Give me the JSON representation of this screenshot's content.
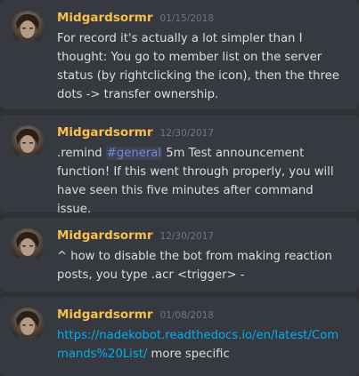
{
  "messages": [
    {
      "username": "Midgardsormr",
      "timestamp": "01/15/2018",
      "text": "For record it's actually a lot simpler than I thought: You go to member list on the server status (by rightclicking the icon), then the three dots -> transfer ownership."
    },
    {
      "username": "Midgardsormr",
      "timestamp": "12/30/2017",
      "text_before": ".remind ",
      "mention": "#general",
      "text_after": " 5m Test announcement function! If this went through properly, you will have seen this five minutes after command issue."
    },
    {
      "username": "Midgardsormr",
      "timestamp": "12/30/2017",
      "text": "^ how to disable the bot from making reaction posts, you type .acr <trigger> -"
    },
    {
      "username": "Midgardsormr",
      "timestamp": "01/08/2018",
      "link_line1": "https://nadekobot.readthedocs.io/en/latest/Com",
      "link_line2": "mands%20List/",
      "text_after": " more specific"
    }
  ],
  "colors": {
    "username": "#f7c04a",
    "timestamp": "#72767d",
    "text": "#dcddde",
    "mention": "#7289da",
    "link": "#00b0f4",
    "background": "#36393f"
  }
}
